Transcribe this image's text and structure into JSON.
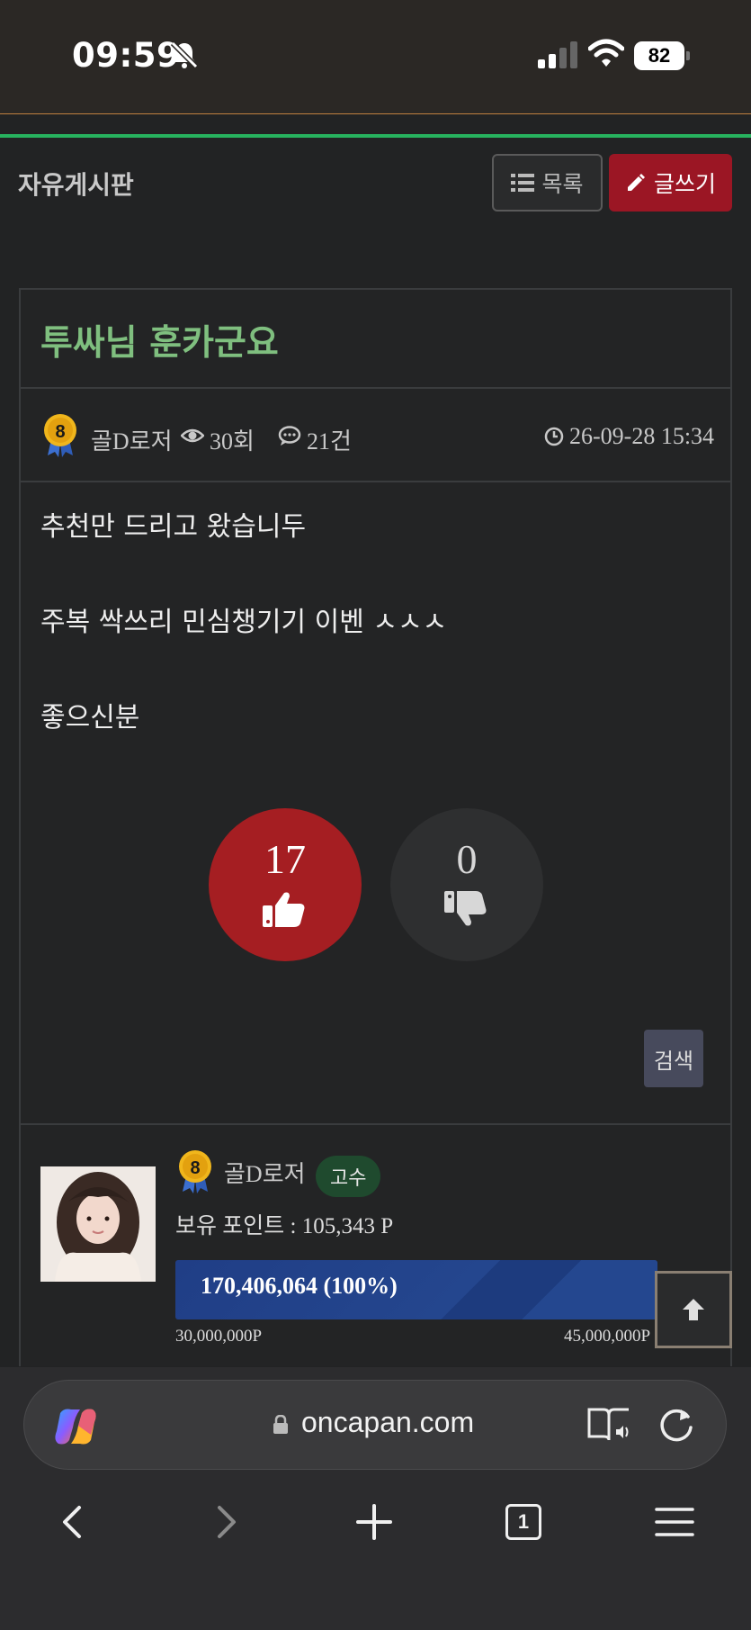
{
  "status_bar": {
    "time": "09:59",
    "battery": "82"
  },
  "header": {
    "board_title": "자유게시판",
    "list_button": "목록",
    "write_button": "글쓰기"
  },
  "post": {
    "title": "투싸님 훈카군요",
    "level": "8",
    "author": "골D로저",
    "views": "30회",
    "comments": "21건",
    "datetime": "26-09-28 15:34",
    "content": [
      "추천만 드리고 왔습니두",
      "주복 싹쓰리 민심챙기기 이벤 ㅅㅅㅅ",
      "좋으신분"
    ],
    "upvotes": "17",
    "downvotes": "0",
    "search_button": "검색"
  },
  "author_card": {
    "level": "8",
    "name": "골D로저",
    "rank": "고수",
    "points": "보유 포인트 : 105,343 P",
    "progress_label": "170,406,064 (100%)",
    "progress_fraction": 1.0,
    "range_min": "30,000,000P",
    "range_max": "45,000,000P"
  },
  "browser": {
    "url": "oncapan.com",
    "tab_count": "1"
  },
  "colors": {
    "accent_green": "#27b35f",
    "write_red": "#9b1624",
    "vote_red": "#a51e22",
    "title_green": "#7fbf7f",
    "progress_blue": "#24468e"
  }
}
